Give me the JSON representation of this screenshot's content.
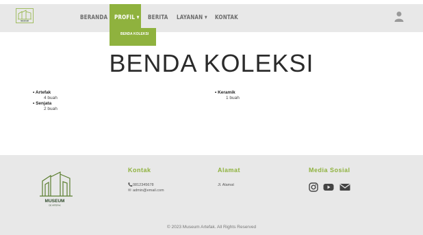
{
  "brand": {
    "name": "MUSEUM",
    "tagline": "DE ARTEFAK"
  },
  "nav": {
    "items": [
      {
        "label": "BERANDA"
      },
      {
        "label": "PROFIL"
      },
      {
        "label": "BERITA"
      },
      {
        "label": "LAYANAN"
      },
      {
        "label": "KONTAK"
      }
    ],
    "active_index": 1,
    "dropdown": {
      "items": [
        {
          "label": "BENDA KOLEKSI"
        }
      ]
    },
    "accent_color": "#8fb23e"
  },
  "main": {
    "title": "BENDA KOLEKSI",
    "left_list": [
      {
        "name": "Artefak",
        "count": "4 buah"
      },
      {
        "name": "Senjata",
        "count": "2 buah"
      }
    ],
    "right_list": [
      {
        "name": "Keramik",
        "count": "1 buah"
      }
    ]
  },
  "footer": {
    "contact": {
      "heading": "Kontak",
      "phone": "0812345678",
      "email": "admin@email.com"
    },
    "address": {
      "heading": "Alamat",
      "text": "Jl. Alamat"
    },
    "social": {
      "heading": "Media Sosial",
      "icons": [
        "instagram-icon",
        "youtube-icon",
        "email-icon"
      ]
    },
    "copyright": "© 2023 Museum Artefak. All Rights Reserved"
  }
}
